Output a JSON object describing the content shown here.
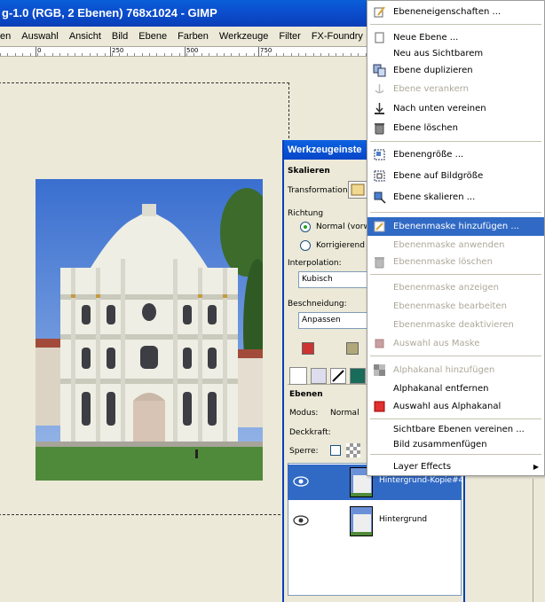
{
  "window": {
    "title": "g-1.0 (RGB, 2 Ebenen) 768x1024 - GIMP"
  },
  "menubar": [
    "en",
    "Auswahl",
    "Ansicht",
    "Bild",
    "Ebene",
    "Farben",
    "Werkzeuge",
    "Filter",
    "FX-Foundry"
  ],
  "ruler": {
    "ticks": [
      "0",
      "250",
      "500",
      "750"
    ]
  },
  "tool_options": {
    "title": "Werkzeugeinste",
    "tool_name": "Skalieren",
    "transformation_label": "Transformation:",
    "direction_label": "Richtung",
    "direction_options": [
      "Normal (vorw",
      "Korrigierend (r"
    ],
    "direction_selected": "Normal (vorw",
    "interpolation_label": "Interpolation:",
    "interpolation_value": "Kubisch",
    "clipping_label": "Beschneidung:",
    "clipping_value": "Anpassen"
  },
  "layers_panel": {
    "title": "Ebenen",
    "mode_label": "Modus:",
    "mode_value": "Normal",
    "opacity_label": "Deckkraft:",
    "lock_label": "Sperre:",
    "layers": [
      {
        "name": "Hintergrund-Kopie#4",
        "selected": true
      },
      {
        "name": "Hintergrund",
        "selected": false
      }
    ]
  },
  "context_menu": {
    "items": [
      {
        "label": "Ebeneneigenschaften ...",
        "icon": "layer-properties-icon",
        "disabled": false
      },
      {
        "label": "Neue Ebene ...",
        "icon": "new-layer-icon",
        "disabled": false
      },
      {
        "label": "Neu aus Sichtbarem",
        "icon": "",
        "disabled": false
      },
      {
        "label": "Ebene duplizieren",
        "icon": "duplicate-layer-icon",
        "disabled": false
      },
      {
        "label": "Ebene verankern",
        "icon": "anchor-icon",
        "disabled": true
      },
      {
        "label": "Nach unten vereinen",
        "icon": "merge-down-icon",
        "disabled": false
      },
      {
        "label": "Ebene löschen",
        "icon": "trash-icon",
        "disabled": false
      },
      {
        "label": "Ebenengröße ...",
        "icon": "layer-boundary-icon",
        "disabled": false
      },
      {
        "label": "Ebene auf Bildgröße",
        "icon": "layer-to-image-size-icon",
        "disabled": false
      },
      {
        "label": "Ebene skalieren ...",
        "icon": "scale-layer-icon",
        "disabled": false
      },
      {
        "label": "Ebenenmaske hinzufügen ...",
        "icon": "add-mask-icon",
        "disabled": false,
        "highlighted": true
      },
      {
        "label": "Ebenenmaske anwenden",
        "icon": "",
        "disabled": true
      },
      {
        "label": "Ebenenmaske löschen",
        "icon": "trash-icon",
        "disabled": true
      },
      {
        "label": "Ebenenmaske anzeigen",
        "icon": "",
        "disabled": true
      },
      {
        "label": "Ebenenmaske bearbeiten",
        "icon": "",
        "disabled": true
      },
      {
        "label": "Ebenenmaske deaktivieren",
        "icon": "",
        "disabled": true
      },
      {
        "label": "Auswahl aus Maske",
        "icon": "selection-from-mask-icon",
        "disabled": true
      },
      {
        "label": "Alphakanal hinzufügen",
        "icon": "alpha-icon",
        "disabled": true
      },
      {
        "label": "Alphakanal entfernen",
        "icon": "",
        "disabled": false
      },
      {
        "label": "Auswahl aus Alphakanal",
        "icon": "alpha-to-selection-icon",
        "disabled": false
      },
      {
        "label": "Sichtbare Ebenen vereinen ...",
        "icon": "",
        "disabled": false
      },
      {
        "label": "Bild zusammenfügen",
        "icon": "",
        "disabled": false
      },
      {
        "label": "Layer Effects",
        "icon": "",
        "disabled": false,
        "submenu": true
      }
    ]
  },
  "colors": {
    "selection_highlight": "#316ac5",
    "titlebar": "#0a5fd8",
    "disabled_text": "#aca899"
  }
}
